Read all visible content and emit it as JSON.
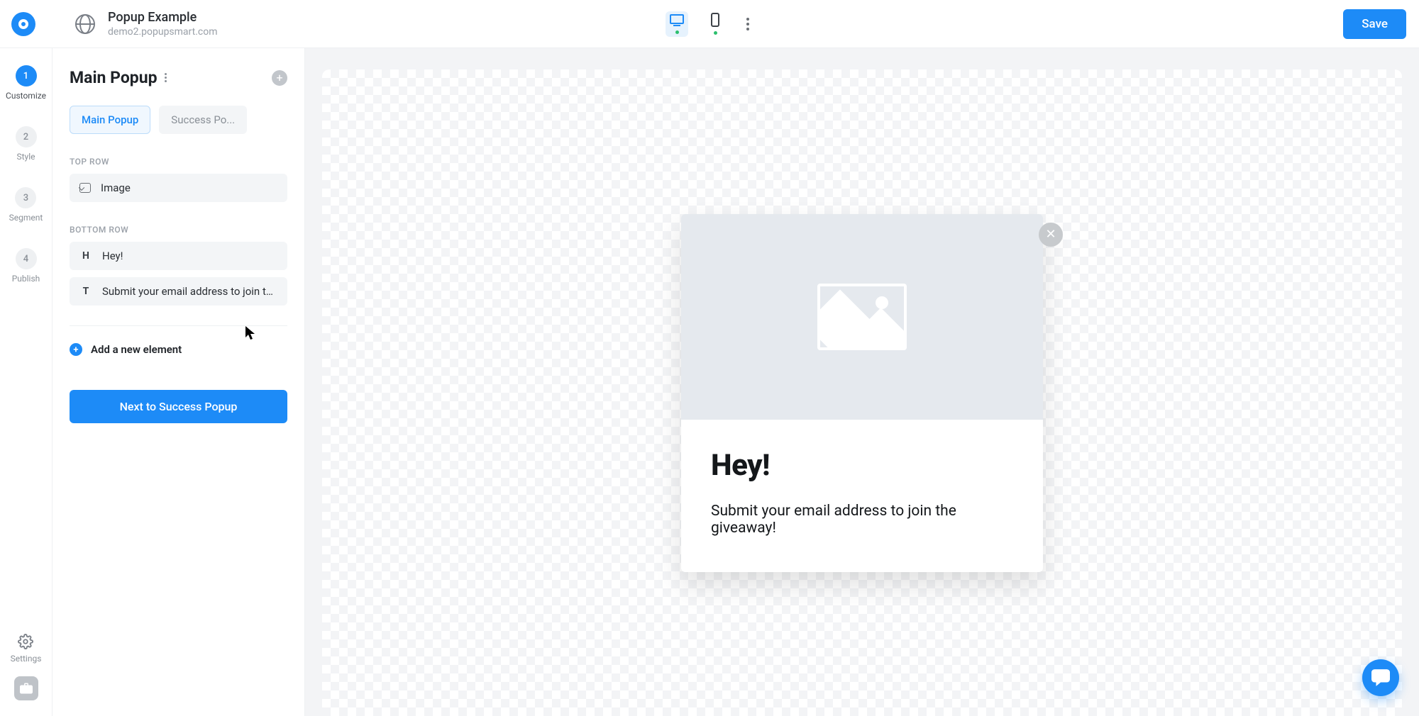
{
  "header": {
    "title": "Popup Example",
    "subtitle": "demo2.popupsmart.com",
    "save": "Save"
  },
  "rail": {
    "steps": [
      {
        "num": "1",
        "label": "Customize",
        "active": true
      },
      {
        "num": "2",
        "label": "Style",
        "active": false
      },
      {
        "num": "3",
        "label": "Segment",
        "active": false
      },
      {
        "num": "4",
        "label": "Publish",
        "active": false
      }
    ],
    "settings": "Settings"
  },
  "panel": {
    "title": "Main Popup",
    "tabs": [
      {
        "label": "Main Popup",
        "active": true
      },
      {
        "label": "Success Po...",
        "active": false
      }
    ],
    "sections": {
      "top": {
        "label": "TOP ROW",
        "items": [
          {
            "type": "image",
            "label": "Image"
          }
        ]
      },
      "bottom": {
        "label": "BOTTOM ROW",
        "items": [
          {
            "type": "H",
            "label": "Hey!"
          },
          {
            "type": "T",
            "label": "Submit your email address to join th..."
          }
        ]
      }
    },
    "add_element": "Add a new element",
    "next": "Next to Success Popup"
  },
  "preview": {
    "headline": "Hey!",
    "subtext": "Submit your email address to join the giveaway!"
  },
  "colors": {
    "primary": "#1d8bf7"
  }
}
